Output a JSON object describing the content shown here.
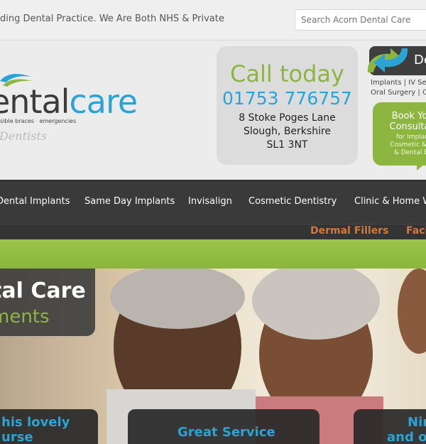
{
  "top": {
    "tagline": "ading Dental Practice. We Are Both NHS & Private",
    "search_placeholder": "Search Acorn Dental Care"
  },
  "logo": {
    "main_part1": "ental",
    "main_part2": "care",
    "sub_part1": "sible braces",
    "sub_part2": "emergencies",
    "dentists": "Dentists",
    "colors": {
      "dark": "#3b3b3b",
      "blue": "#2aa4d5",
      "green": "#8db640"
    }
  },
  "call": {
    "title": "Call today",
    "phone": "01753 776757",
    "address": [
      "8 Stoke Poges Lane",
      "Slough, Berkshire",
      "SL1 3NT"
    ]
  },
  "side": {
    "tab_text": "De",
    "services_line1": "Implants | IV Sed",
    "services_line2": "Oral Surgery | O",
    "book_line1": "Book Yo",
    "book_line2": "Consulta",
    "book_sub1": "for Implan",
    "book_sub2": "Cosmetic & W",
    "book_sub3": "& Dental Br"
  },
  "nav": {
    "items": [
      "Dental Implants",
      "Same Day Implants",
      "Invisalign",
      "Cosmetic Dentistry",
      "Clinic & Home W"
    ],
    "sub_items": [
      "Dermal Fillers",
      "Facia"
    ]
  },
  "hero": {
    "title": "tal Care",
    "subtitle": "ments",
    "panel1_line1": "his lovely",
    "panel1_line2": "urse",
    "panel2": "Great Service",
    "panel3_line1": "Nin",
    "panel3_line2": "and o"
  }
}
